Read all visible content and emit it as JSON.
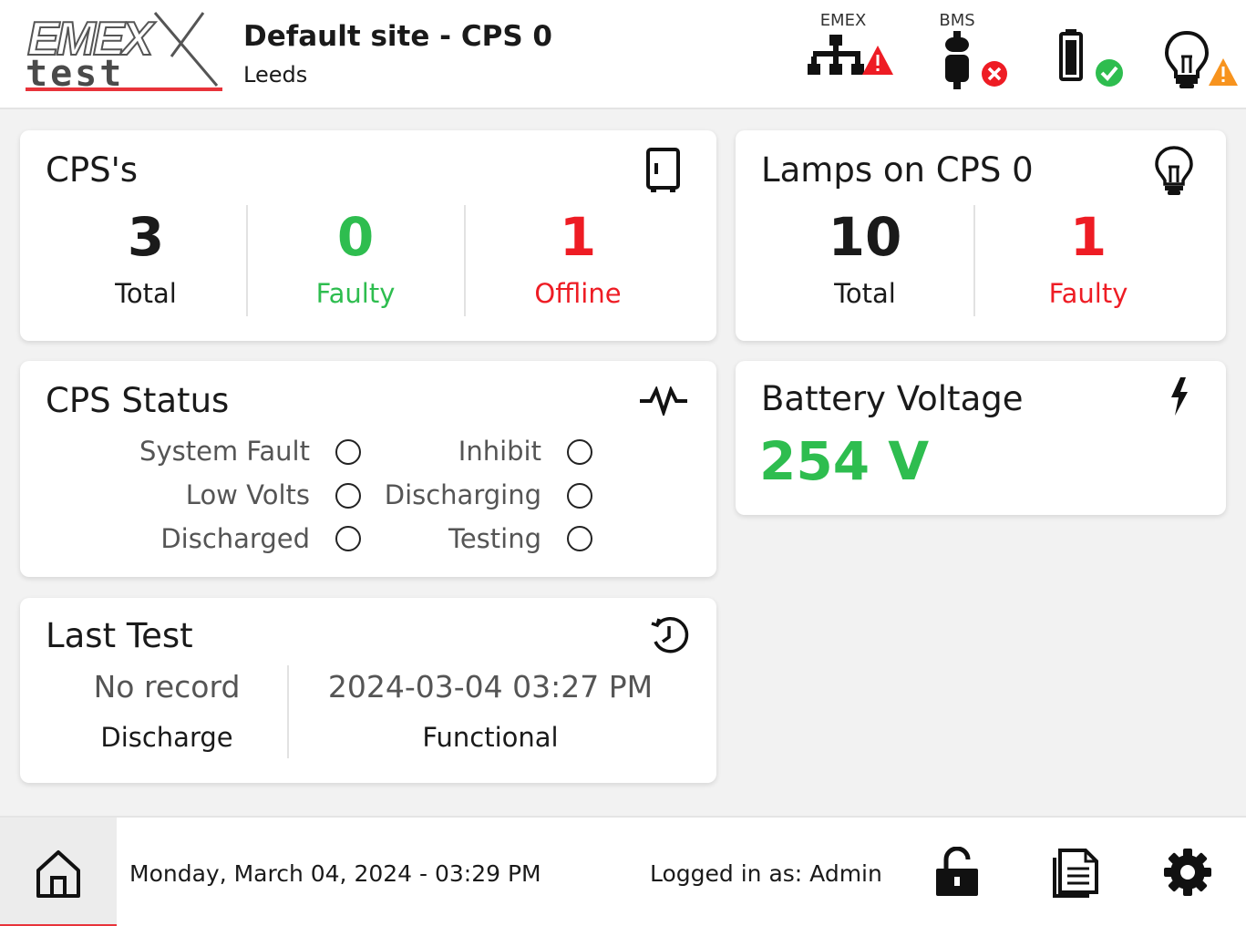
{
  "header": {
    "logo_text_top": "EMEX",
    "logo_text_bottom": "test",
    "site_title": "Default site - CPS 0",
    "site_location": "Leeds",
    "status_icons": [
      {
        "label": "EMEX",
        "icon": "network-icon",
        "badge": "warning-triangle-red"
      },
      {
        "label": "BMS",
        "icon": "battery-cell-icon",
        "badge": "error-x-red"
      },
      {
        "label": "",
        "icon": "battery-icon",
        "badge": "ok-check-green"
      },
      {
        "label": "",
        "icon": "lamp-icon",
        "badge": "warning-triangle-orange"
      }
    ]
  },
  "cps_card": {
    "title": "CPS's",
    "icon": "cabinet-icon",
    "stats": [
      {
        "value": "3",
        "label": "Total"
      },
      {
        "value": "0",
        "label": "Faulty"
      },
      {
        "value": "1",
        "label": "Offline"
      }
    ]
  },
  "lamps_card": {
    "title": "Lamps on CPS 0",
    "icon": "bulb-icon",
    "stats": [
      {
        "value": "10",
        "label": "Total"
      },
      {
        "value": "1",
        "label": "Faulty"
      }
    ]
  },
  "status_card": {
    "title": "CPS Status",
    "icon": "pulse-icon",
    "items": [
      {
        "label": "System Fault",
        "on": false
      },
      {
        "label": "Inhibit",
        "on": false
      },
      {
        "label": "Low Volts",
        "on": false
      },
      {
        "label": "Discharging",
        "on": false
      },
      {
        "label": "Discharged",
        "on": false
      },
      {
        "label": "Testing",
        "on": false
      }
    ]
  },
  "battery_card": {
    "title": "Battery Voltage",
    "icon": "lightning-icon",
    "value": "254 V"
  },
  "last_test_card": {
    "title": "Last Test",
    "icon": "history-clock-icon",
    "tests": [
      {
        "value": "No record",
        "label": "Discharge"
      },
      {
        "value": "2024-03-04 03:27 PM",
        "label": "Functional"
      }
    ]
  },
  "footer": {
    "datetime": "Monday, March 04, 2024 - 03:29 PM",
    "logged_in": "Logged in as: Admin",
    "icons": [
      "home-icon",
      "unlock-icon",
      "documents-icon",
      "gear-icon"
    ]
  },
  "colors": {
    "ok_green": "#2ebd4f",
    "alert_red": "#ee1c24",
    "warning_orange": "#f7931e",
    "brand_red": "#e8333a"
  }
}
